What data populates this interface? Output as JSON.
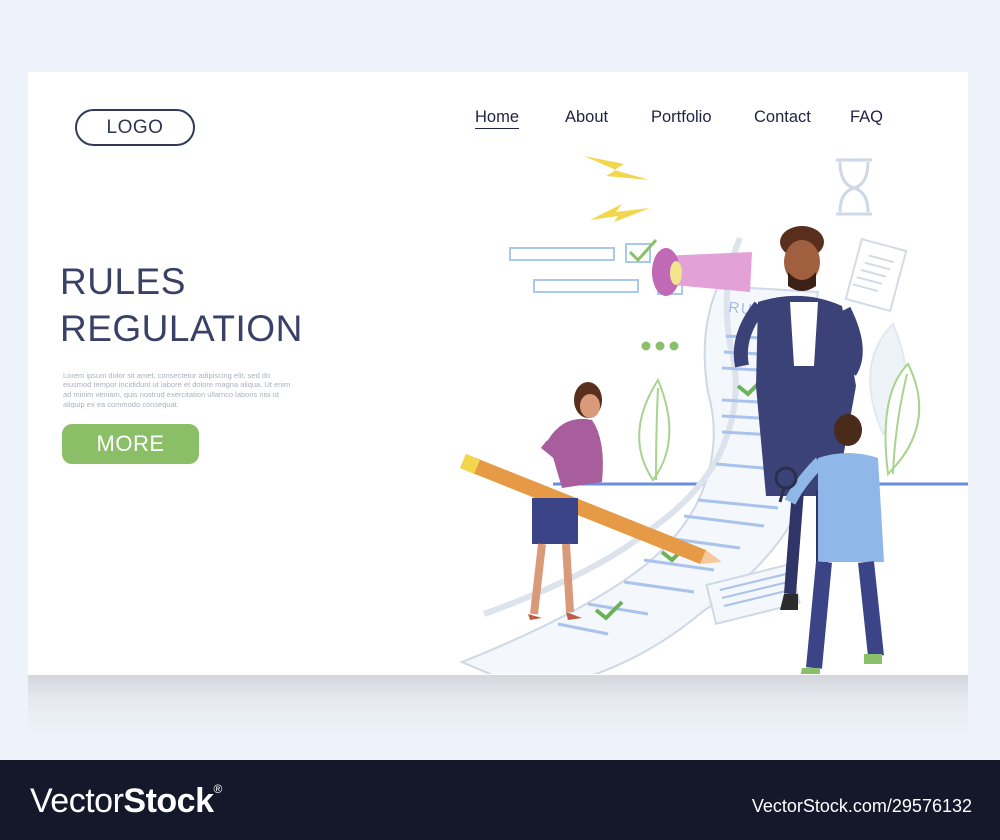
{
  "header": {
    "logo": "LOGO",
    "nav": [
      {
        "label": "Home",
        "active": true
      },
      {
        "label": "About",
        "active": false
      },
      {
        "label": "Portfolio",
        "active": false
      },
      {
        "label": "Contact",
        "active": false
      },
      {
        "label": "FAQ",
        "active": false
      }
    ]
  },
  "hero": {
    "title_line1": "RULES",
    "title_line2": "REGULATION",
    "description": "Lorem ipsum dolor sit amet, consectetur adipiscing elit, sed do eiusmod tempor incididunt ut labore et dolore magna aliqua. Ut enim ad minim veniam, quis nostrud exercitation ullamco laboris nisi ut aliquip ex ea commodo consequat.",
    "cta_label": "MORE"
  },
  "illustration": {
    "document_label": "RULES"
  },
  "colors": {
    "accent_green": "#8bbf67",
    "text_navy": "#3b4066",
    "footer_bg": "#15182a"
  },
  "footer": {
    "brand_light": "Vector",
    "brand_bold": "Stock",
    "brand_mark": "®",
    "asset_id": "VectorStock.com/29576132"
  }
}
